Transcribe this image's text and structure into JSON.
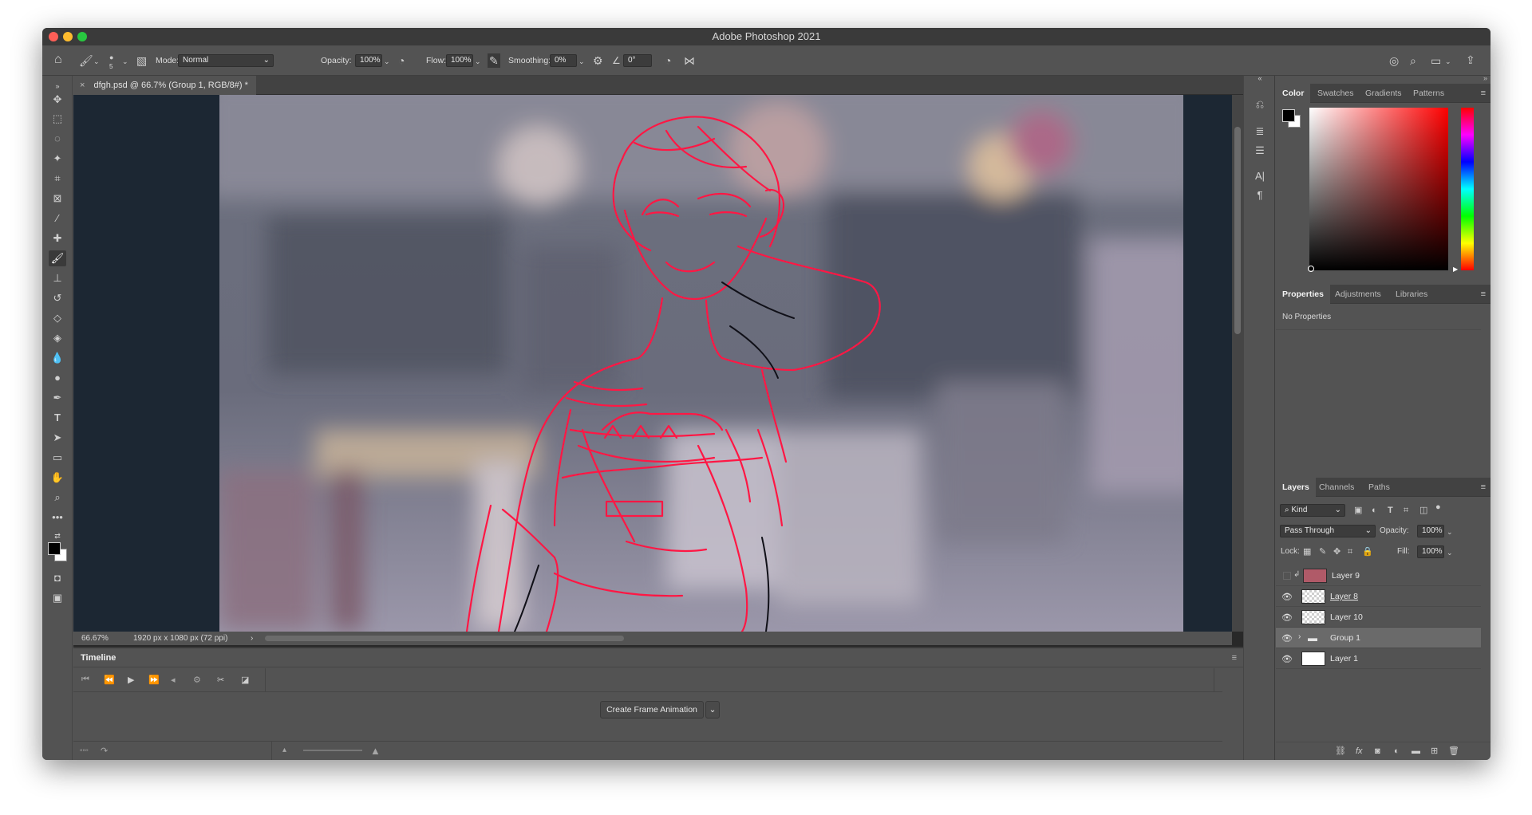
{
  "window": {
    "title": "Adobe Photoshop 2021"
  },
  "options": {
    "mode_label": "Mode:",
    "mode_value": "Normal",
    "opacity_label": "Opacity:",
    "opacity_value": "100%",
    "flow_label": "Flow:",
    "flow_value": "100%",
    "smoothing_label": "Smoothing:",
    "smoothing_value": "0%",
    "angle_value": "0°",
    "brush_size": "5"
  },
  "document": {
    "tab_title": "dfgh.psd @ 66.7% (Group 1, RGB/8#) *",
    "zoom": "66.67%",
    "dimensions": "1920 px x 1080 px (72 ppi)"
  },
  "timeline": {
    "title": "Timeline",
    "create_button": "Create Frame Animation"
  },
  "color_panel": {
    "tabs": [
      "Color",
      "Swatches",
      "Gradients",
      "Patterns"
    ]
  },
  "properties_panel": {
    "tabs": [
      "Properties",
      "Adjustments",
      "Libraries"
    ],
    "empty_text": "No Properties"
  },
  "layers_panel": {
    "tabs": [
      "Layers",
      "Channels",
      "Paths"
    ],
    "filter_value": "Kind",
    "blend_mode": "Pass Through",
    "opacity_label": "Opacity:",
    "opacity_value": "100%",
    "lock_label": "Lock:",
    "fill_label": "Fill:",
    "fill_value": "100%",
    "layers": [
      {
        "name": "Layer 9",
        "visible": false,
        "thumb": "#b05a68"
      },
      {
        "name": "Layer 8",
        "visible": true,
        "thumb": "checker"
      },
      {
        "name": "Layer 10",
        "visible": true,
        "thumb": "checker"
      },
      {
        "name": "Group 1",
        "visible": true,
        "thumb": "folder"
      },
      {
        "name": "Layer 1",
        "visible": true,
        "thumb": "#ffffff"
      }
    ]
  },
  "colors": {
    "accent_stroke": "#ff1744",
    "foreground": "#000000",
    "background": "#ffffff"
  }
}
